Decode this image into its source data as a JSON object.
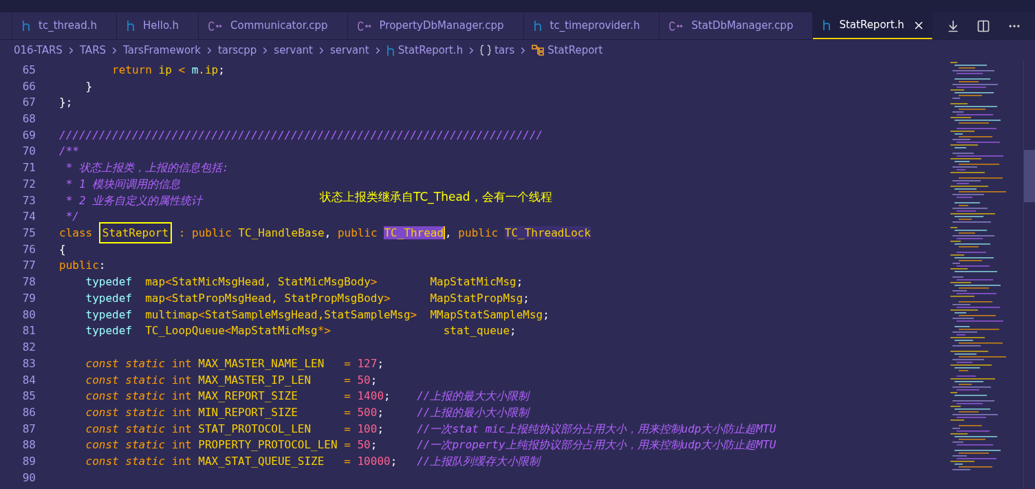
{
  "tabs": [
    {
      "label": "tc_thread.h",
      "kind": "header",
      "selected": false
    },
    {
      "label": "Hello.h",
      "kind": "header",
      "selected": false
    },
    {
      "label": "Communicator.cpp",
      "kind": "cpp",
      "selected": false
    },
    {
      "label": "PropertyDbManager.cpp",
      "kind": "cpp",
      "selected": false
    },
    {
      "label": "tc_timeprovider.h",
      "kind": "header",
      "selected": false
    },
    {
      "label": "StatDbManager.cpp",
      "kind": "cpp",
      "selected": false
    },
    {
      "label": "StatReport.h",
      "kind": "header",
      "selected": true
    }
  ],
  "breadcrumbs": [
    {
      "label": "016-TARS",
      "kind": "folder"
    },
    {
      "label": "TARS",
      "kind": "folder"
    },
    {
      "label": "TarsFramework",
      "kind": "folder"
    },
    {
      "label": "tarscpp",
      "kind": "folder"
    },
    {
      "label": "servant",
      "kind": "folder"
    },
    {
      "label": "servant",
      "kind": "folder"
    },
    {
      "label": "StatReport.h",
      "kind": "header"
    },
    {
      "label": "tars",
      "kind": "namespace"
    },
    {
      "label": "StatReport",
      "kind": "class"
    }
  ],
  "code_lines": [
    {
      "number": "65",
      "tokens": [
        {
          "text": "        return ",
          "kind": "keyword"
        },
        {
          "text": "ip ",
          "kind": "name"
        },
        {
          "text": "< ",
          "kind": "keyword"
        },
        {
          "text": "m",
          "kind": "member"
        },
        {
          "text": ".ip",
          "kind": "name"
        },
        {
          "text": ";",
          "kind": "plain"
        }
      ]
    },
    {
      "number": "66",
      "tokens": [
        {
          "text": "    }",
          "kind": "plain"
        }
      ]
    },
    {
      "number": "67",
      "tokens": [
        {
          "text": "};",
          "kind": "plain"
        }
      ]
    },
    {
      "number": "68"
    },
    {
      "number": "69",
      "tokens": [
        {
          "text": "/////////////////////////////////////////////////////////////////////////",
          "kind": "comment"
        }
      ]
    },
    {
      "number": "70",
      "tokens": [
        {
          "text": "/**",
          "kind": "comment"
        }
      ]
    },
    {
      "number": "71",
      "tokens": [
        {
          "text": " * 状态上报类，上报的信息包括:",
          "kind": "comment"
        }
      ]
    },
    {
      "number": "72",
      "tokens": [
        {
          "text": " * 1 模块间调用的信息",
          "kind": "comment"
        }
      ]
    },
    {
      "number": "73",
      "tokens": [
        {
          "text": " * 2 业务自定义的属性统计",
          "kind": "comment"
        }
      ]
    },
    {
      "number": "74",
      "tokens": [
        {
          "text": " */",
          "kind": "comment"
        }
      ]
    },
    {
      "number": "75",
      "tokens": [
        {
          "text": "class ",
          "kind": "keyword"
        },
        {
          "text": "StatReport",
          "kind": "boxed"
        },
        {
          "text": " : public ",
          "kind": "keyword"
        },
        {
          "text": "TC_HandleBase",
          "kind": "name"
        },
        {
          "text": ", ",
          "kind": "plain"
        },
        {
          "text": "public ",
          "kind": "keyword"
        },
        {
          "text": "TC_Thread",
          "kind": "selected"
        },
        {
          "text": ", ",
          "kind": "plain"
        },
        {
          "text": "public ",
          "kind": "keyword"
        },
        {
          "text": "TC_ThreadLock",
          "kind": "match"
        }
      ]
    },
    {
      "number": "76",
      "tokens": [
        {
          "text": "{",
          "kind": "plain"
        }
      ]
    },
    {
      "number": "77",
      "tokens": [
        {
          "text": "public",
          "kind": "keyword"
        },
        {
          "text": ":",
          "kind": "plain"
        }
      ]
    },
    {
      "number": "78",
      "tokens": [
        {
          "text": "    typedef  ",
          "kind": "type"
        },
        {
          "text": "map",
          "kind": "name"
        },
        {
          "text": "<",
          "kind": "keyword"
        },
        {
          "text": "StatMicMsgHead, StatMicMsgBody",
          "kind": "name"
        },
        {
          "text": ">",
          "kind": "keyword"
        },
        {
          "text": "        MapStatMicMsg",
          "kind": "name"
        },
        {
          "text": ";",
          "kind": "plain"
        }
      ]
    },
    {
      "number": "79",
      "tokens": [
        {
          "text": "    typedef  ",
          "kind": "type"
        },
        {
          "text": "map",
          "kind": "name"
        },
        {
          "text": "<",
          "kind": "keyword"
        },
        {
          "text": "StatPropMsgHead, StatPropMsgBody",
          "kind": "name"
        },
        {
          "text": ">",
          "kind": "keyword"
        },
        {
          "text": "      MapStatPropMsg",
          "kind": "name"
        },
        {
          "text": ";",
          "kind": "plain"
        }
      ]
    },
    {
      "number": "80",
      "tokens": [
        {
          "text": "    typedef  ",
          "kind": "type"
        },
        {
          "text": "multimap",
          "kind": "name"
        },
        {
          "text": "<",
          "kind": "keyword"
        },
        {
          "text": "StatSampleMsgHead,StatSampleMsg",
          "kind": "name"
        },
        {
          "text": ">",
          "kind": "keyword"
        },
        {
          "text": "  MMapStatSampleMsg",
          "kind": "name"
        },
        {
          "text": ";",
          "kind": "plain"
        }
      ]
    },
    {
      "number": "81",
      "tokens": [
        {
          "text": "    typedef  ",
          "kind": "type"
        },
        {
          "text": "TC_LoopQueue",
          "kind": "name"
        },
        {
          "text": "<",
          "kind": "keyword"
        },
        {
          "text": "MapStatMicMsg",
          "kind": "name"
        },
        {
          "text": "*>",
          "kind": "keyword"
        },
        {
          "text": "                 stat_queue",
          "kind": "name"
        },
        {
          "text": ";",
          "kind": "plain"
        }
      ]
    },
    {
      "number": "82"
    },
    {
      "number": "83",
      "tokens": [
        {
          "text": "    const static ",
          "kind": "storage"
        },
        {
          "text": "int ",
          "kind": "keyword"
        },
        {
          "text": "MAX_MASTER_NAME_LEN   ",
          "kind": "name"
        },
        {
          "text": "= ",
          "kind": "keyword"
        },
        {
          "text": "127",
          "kind": "number"
        },
        {
          "text": ";",
          "kind": "plain"
        }
      ]
    },
    {
      "number": "84",
      "tokens": [
        {
          "text": "    const static ",
          "kind": "storage"
        },
        {
          "text": "int ",
          "kind": "keyword"
        },
        {
          "text": "MAX_MASTER_IP_LEN     ",
          "kind": "name"
        },
        {
          "text": "= ",
          "kind": "keyword"
        },
        {
          "text": "50",
          "kind": "number"
        },
        {
          "text": ";",
          "kind": "plain"
        }
      ]
    },
    {
      "number": "85",
      "tokens": [
        {
          "text": "    const static ",
          "kind": "storage"
        },
        {
          "text": "int ",
          "kind": "keyword"
        },
        {
          "text": "MAX_REPORT_SIZE       ",
          "kind": "name"
        },
        {
          "text": "= ",
          "kind": "keyword"
        },
        {
          "text": "1400",
          "kind": "number"
        },
        {
          "text": ";",
          "kind": "plain"
        },
        {
          "text": "    //上报的最大大小限制",
          "kind": "comment"
        }
      ]
    },
    {
      "number": "86",
      "tokens": [
        {
          "text": "    const static ",
          "kind": "storage"
        },
        {
          "text": "int ",
          "kind": "keyword"
        },
        {
          "text": "MIN_REPORT_SIZE       ",
          "kind": "name"
        },
        {
          "text": "= ",
          "kind": "keyword"
        },
        {
          "text": "500",
          "kind": "number"
        },
        {
          "text": ";",
          "kind": "plain"
        },
        {
          "text": "     //上报的最小大小限制",
          "kind": "comment"
        }
      ]
    },
    {
      "number": "87",
      "tokens": [
        {
          "text": "    const static ",
          "kind": "storage"
        },
        {
          "text": "int ",
          "kind": "keyword"
        },
        {
          "text": "STAT_PROTOCOL_LEN     ",
          "kind": "name"
        },
        {
          "text": "= ",
          "kind": "keyword"
        },
        {
          "text": "100",
          "kind": "number"
        },
        {
          "text": ";",
          "kind": "plain"
        },
        {
          "text": "     //一次stat mic上报纯协议部分占用大小，用来控制udp大小防止超MTU",
          "kind": "comment"
        }
      ]
    },
    {
      "number": "88",
      "tokens": [
        {
          "text": "    const static ",
          "kind": "storage"
        },
        {
          "text": "int ",
          "kind": "keyword"
        },
        {
          "text": "PROPERTY_PROTOCOL_LEN ",
          "kind": "name"
        },
        {
          "text": "= ",
          "kind": "keyword"
        },
        {
          "text": "50",
          "kind": "number"
        },
        {
          "text": ";",
          "kind": "plain"
        },
        {
          "text": "      //一次property上纯报协议部分占用大小，用来控制udp大小防止超MTU",
          "kind": "comment"
        }
      ]
    },
    {
      "number": "89",
      "tokens": [
        {
          "text": "    const static ",
          "kind": "storage"
        },
        {
          "text": "int ",
          "kind": "keyword"
        },
        {
          "text": "MAX_STAT_QUEUE_SIZE   ",
          "kind": "name"
        },
        {
          "text": "= ",
          "kind": "keyword"
        },
        {
          "text": "10000",
          "kind": "number"
        },
        {
          "text": ";",
          "kind": "plain"
        },
        {
          "text": "   //上报队列缓存大小限制",
          "kind": "comment"
        }
      ]
    },
    {
      "number": "90"
    }
  ],
  "annotation": "状态上报类继承自TC_Thead，会有一个线程"
}
